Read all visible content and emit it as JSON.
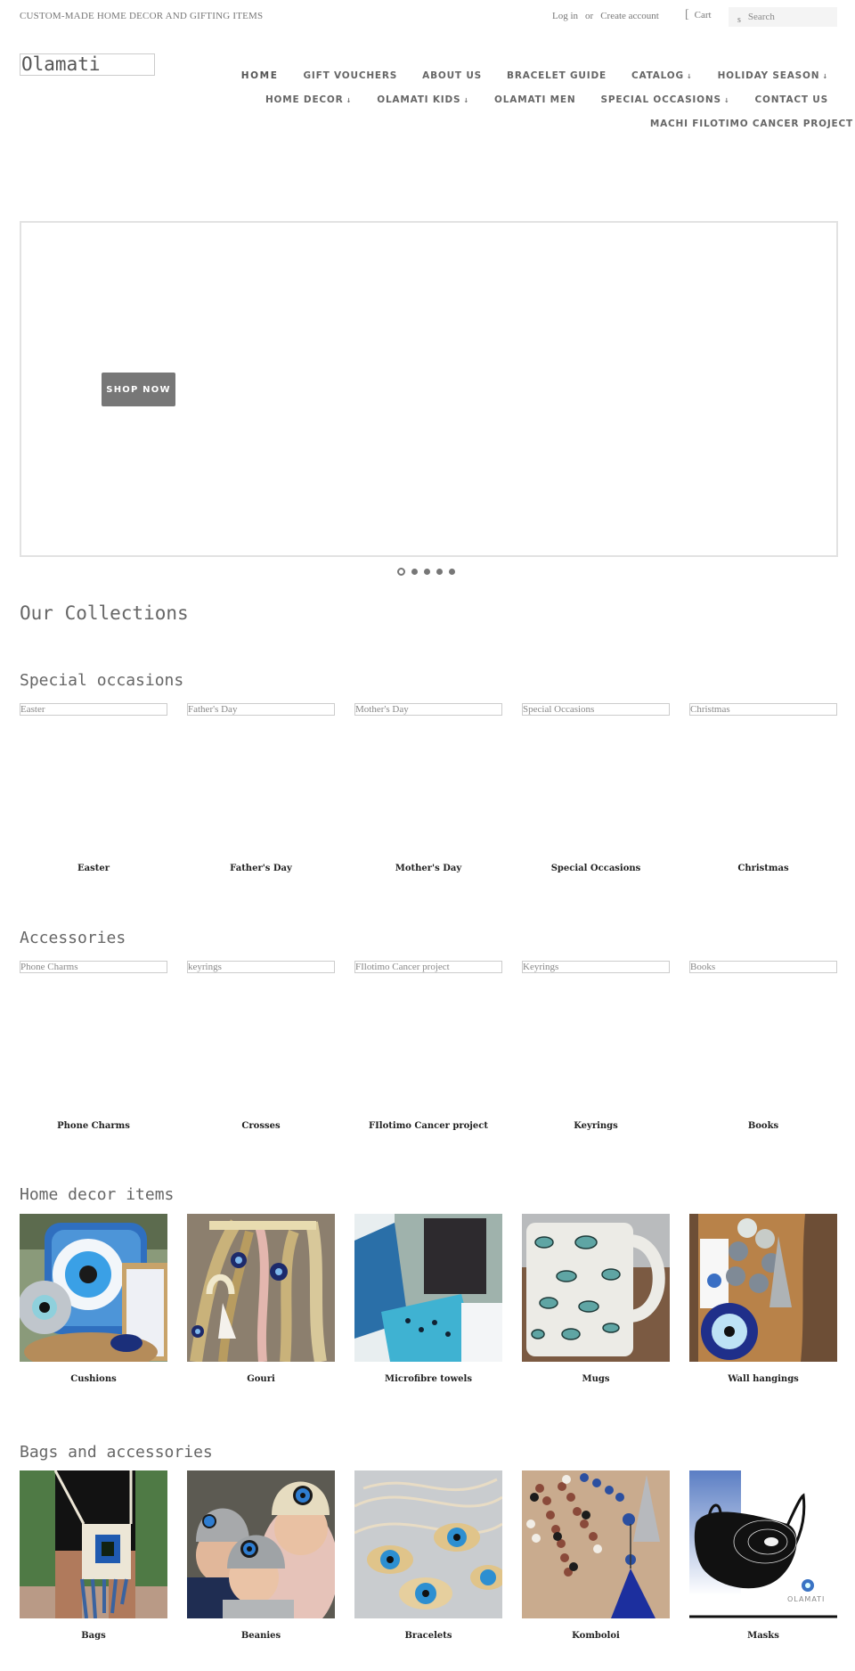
{
  "header": {
    "tagline": "CUSTOM-MADE HOME DECOR AND GIFTING ITEMS",
    "login": "Log in",
    "or": "or",
    "create_account": "Create account",
    "cart_icon": "[",
    "cart": "Cart",
    "search_icon": "s",
    "search_placeholder": "Search",
    "logo": "Olamati"
  },
  "nav": {
    "row1": [
      {
        "label": "HOME",
        "dropdown": false
      },
      {
        "label": "GIFT VOUCHERS",
        "dropdown": false
      },
      {
        "label": "ABOUT US",
        "dropdown": false
      },
      {
        "label": "BRACELET GUIDE",
        "dropdown": false
      },
      {
        "label": "CATALOG",
        "dropdown": true
      },
      {
        "label": "HOLIDAY SEASON",
        "dropdown": true
      }
    ],
    "row2": [
      {
        "label": "HOME DECOR",
        "dropdown": true
      },
      {
        "label": "OLAMATI KIDS",
        "dropdown": true
      },
      {
        "label": "OLAMATI MEN",
        "dropdown": false
      },
      {
        "label": "SPECIAL OCCASIONS",
        "dropdown": true
      },
      {
        "label": "CONTACT US",
        "dropdown": false
      }
    ],
    "row3": [
      {
        "label": "MACHI FILOTIMO CANCER PROJECT",
        "dropdown": false
      }
    ],
    "dropdown_arrow": "↓"
  },
  "hero": {
    "button": "SHOP NOW",
    "slides": 5,
    "active_slide": 1
  },
  "collections": {
    "heading": "Our Collections",
    "sections": [
      {
        "title": "Special occasions",
        "items": [
          {
            "alt": "Easter",
            "title": "Easter"
          },
          {
            "alt": "Father's Day",
            "title": "Father's Day"
          },
          {
            "alt": "Mother's Day",
            "title": "Mother's Day"
          },
          {
            "alt": "Special Occasions",
            "title": "Special Occasions"
          },
          {
            "alt": "Christmas",
            "title": "Christmas"
          }
        ]
      },
      {
        "title": "Accessories",
        "items": [
          {
            "alt": "Phone Charms",
            "title": "Phone Charms"
          },
          {
            "alt": "keyrings",
            "title": "Crosses"
          },
          {
            "alt": "FIlotimo Cancer project",
            "title": "FIlotimo Cancer project"
          },
          {
            "alt": "Keyrings",
            "title": "Keyrings"
          },
          {
            "alt": "Books",
            "title": "Books"
          }
        ]
      },
      {
        "title": "Home decor items",
        "items": [
          {
            "title": "Cushions",
            "image": "evil-eye cushions"
          },
          {
            "title": "Gouri",
            "image": "rope gouri charms"
          },
          {
            "title": "Microfibre towels",
            "image": "blue microfibre towels"
          },
          {
            "title": "Mugs",
            "image": "eye-pattern mug"
          },
          {
            "title": "Wall hangings",
            "image": "evil-eye wall hanging"
          }
        ]
      },
      {
        "title": "Bags and accessories",
        "items": [
          {
            "title": "Bags",
            "image": "crochet evil-eye bag"
          },
          {
            "title": "Beanies",
            "image": "kids in evil-eye beanies"
          },
          {
            "title": "Bracelets",
            "image": "evil-eye bracelets"
          },
          {
            "title": "Komboloi",
            "image": "komboloi with tassels"
          },
          {
            "title": "Masks",
            "image": "black evil-eye mask"
          }
        ]
      }
    ]
  },
  "colors": {
    "text_gray": "#666666",
    "button_gray": "#777777",
    "border": "#e2e2e2",
    "title_dark": "#222222"
  }
}
